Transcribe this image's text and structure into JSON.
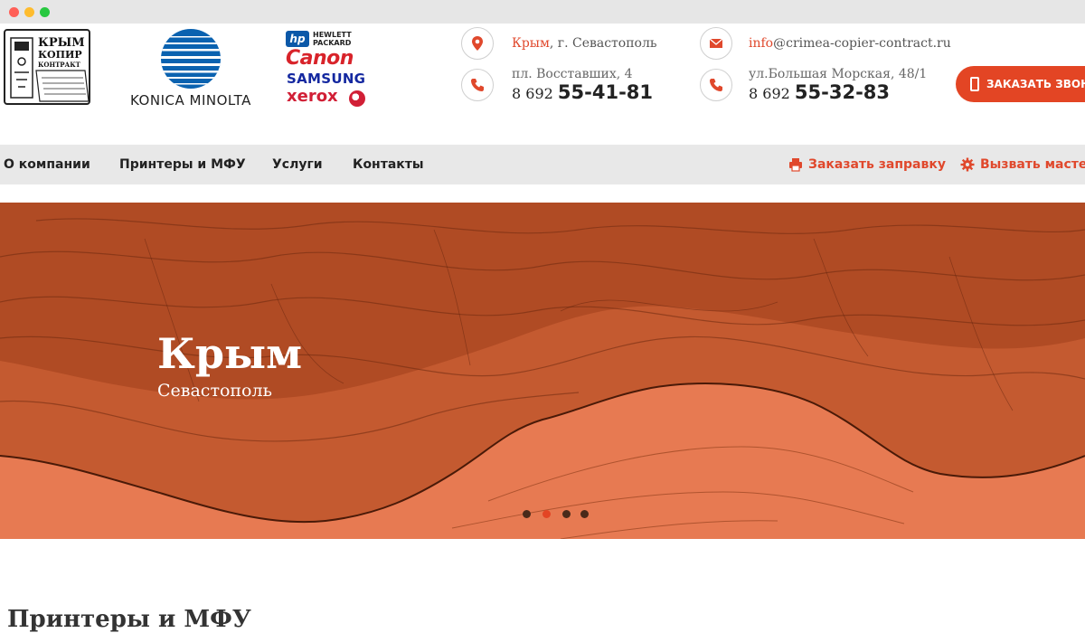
{
  "header": {
    "logo": {
      "line1": "КРЫМ",
      "line2": "КОПИР",
      "line3": "КОНТРАКТ"
    },
    "konica": "KONICA MINOLTA",
    "brands": {
      "hp_badge": "hp",
      "hp_line1": "HEWLETT",
      "hp_line2": "PACKARD",
      "canon": "Canon",
      "samsung": "SAMSUNG",
      "xerox": "xerox"
    },
    "location": {
      "icon": "map-pin-icon",
      "accent": "Крым",
      "rest": ", г. Севастополь"
    },
    "email": {
      "icon": "mail-icon",
      "accent": "info",
      "rest": "@crimea-copier-contract.ru"
    },
    "office1": {
      "icon": "phone-icon",
      "address": "пл. Восставших, 4",
      "code": "8 692",
      "number": "55-41-81"
    },
    "office2": {
      "icon": "phone-icon",
      "address": "ул.Большая Морская, 48/1",
      "code": "8 692",
      "number": "55-32-83"
    },
    "callback_label": "ЗАКАЗАТЬ ЗВОНОК"
  },
  "nav": {
    "items": [
      "О компании",
      "Принтеры и МФУ",
      "Услуги",
      "Контакты"
    ],
    "actions": [
      {
        "label": "Заказать заправку",
        "icon": "printer-icon"
      },
      {
        "label": "Вызвать мастера",
        "icon": "gear-icon"
      }
    ]
  },
  "hero": {
    "title": "Крым",
    "subtitle": "Севастополь",
    "slides_total": 4,
    "active_slide": 2
  },
  "section": {
    "title": "Принтеры и МФУ"
  },
  "colors": {
    "accent": "#e34524",
    "nav_bg": "#e8e8e8",
    "hero_bg": "#e77a52"
  }
}
